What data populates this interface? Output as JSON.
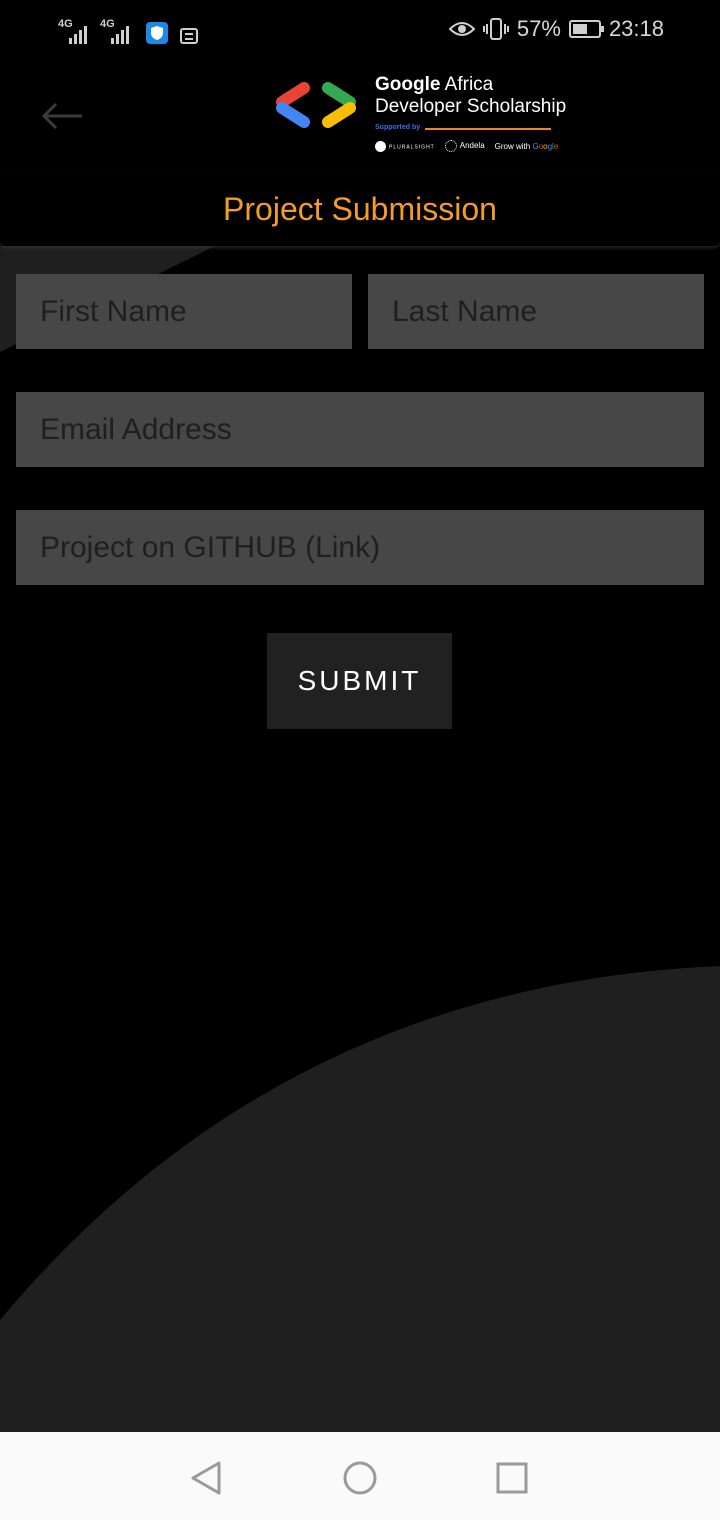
{
  "status_bar": {
    "network_1": "4G",
    "network_2": "4G",
    "battery_percent": "57%",
    "battery_level": 0.57,
    "time": "23:18",
    "icons": [
      "signal-icon",
      "signal-icon",
      "shield-icon",
      "notification-icon",
      "eye-icon",
      "vibrate-icon",
      "battery-icon"
    ]
  },
  "header": {
    "back_icon": "arrow-left-icon",
    "logo": {
      "title_brand": "Google",
      "title_rest": " Africa",
      "title_line2": "Developer Scholarship",
      "supported_by": "Supported by",
      "sponsor_1": "PLURALSIGHT",
      "sponsor_2": "Andela",
      "sponsor_3_prefix": "Grow with ",
      "sponsor_3_brand": [
        "G",
        "o",
        "o",
        "g",
        "l",
        "e"
      ]
    }
  },
  "title": "Project Submission",
  "form": {
    "first_name": {
      "value": "",
      "placeholder": "First Name"
    },
    "last_name": {
      "value": "",
      "placeholder": "Last Name"
    },
    "email": {
      "value": "",
      "placeholder": "Email Address"
    },
    "github": {
      "value": "",
      "placeholder": "Project on GITHUB (Link)"
    },
    "submit_label": "SUBMIT"
  },
  "nav_bar": {
    "back_icon": "triangle-back-icon",
    "home_icon": "circle-home-icon",
    "recents_icon": "square-recents-icon"
  },
  "colors": {
    "accent": "#f39c26",
    "background": "#000000",
    "input_bg": "#474747",
    "button_bg": "#212121",
    "shape_bg": "#201f20"
  }
}
